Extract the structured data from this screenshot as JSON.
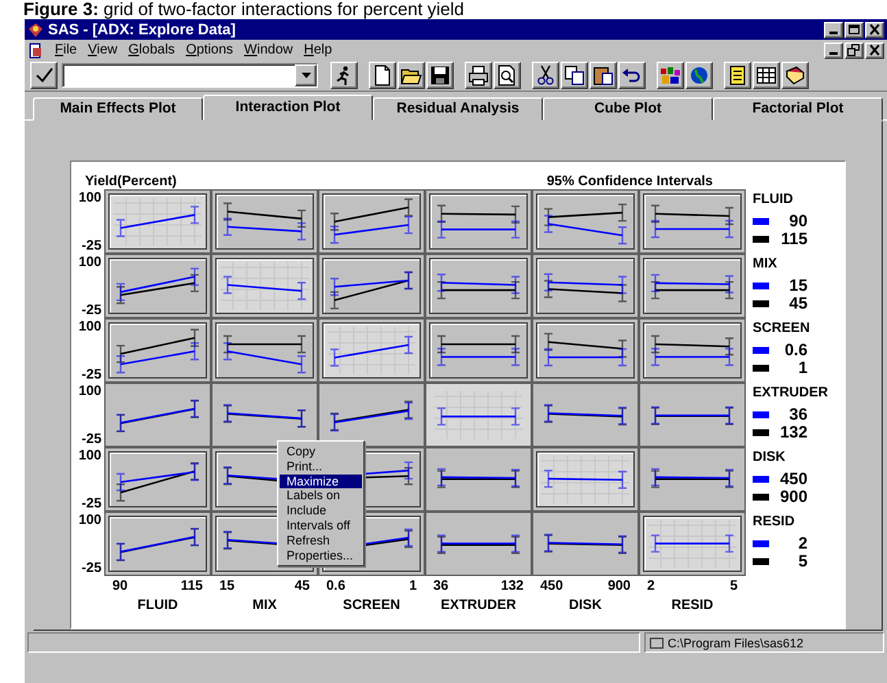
{
  "caption": "**Figure 3:** grid of two-factor interactions for percent yield",
  "window": {
    "title": "SAS - [ADX: Explore Data]"
  },
  "menu": [
    "File",
    "View",
    "Globals",
    "Options",
    "Window",
    "Help"
  ],
  "tabs": [
    {
      "label": "Main Effects Plot",
      "selected": false
    },
    {
      "label": "Interaction Plot",
      "selected": true
    },
    {
      "label": "Residual Analysis",
      "selected": false
    },
    {
      "label": "Cube Plot",
      "selected": false
    },
    {
      "label": "Factorial Plot",
      "selected": false
    }
  ],
  "plot": {
    "ylabel": "Yield(Percent)",
    "title": "95% Confidence Intervals"
  },
  "grid": {
    "columns": [
      {
        "ticks": [
          "90",
          "115"
        ],
        "name": "FLUID"
      },
      {
        "ticks": [
          "15",
          "45"
        ],
        "name": "MIX"
      },
      {
        "ticks": [
          "0.6",
          "1"
        ],
        "name": "SCREEN"
      },
      {
        "ticks": [
          "36",
          "132"
        ],
        "name": "EXTRUDER"
      },
      {
        "ticks": [
          "450",
          "900"
        ],
        "name": "DISK"
      },
      {
        "ticks": [
          "2",
          "5"
        ],
        "name": "RESID"
      }
    ],
    "rows": [
      {
        "yticks": [
          "100",
          "-25"
        ],
        "cells": [
          {
            "kind": "main",
            "framed": true
          },
          {
            "kind": "interaction",
            "framed": true
          },
          {
            "kind": "interaction",
            "framed": true
          },
          {
            "kind": "interaction",
            "framed": true
          },
          {
            "kind": "interaction",
            "framed": true
          },
          {
            "kind": "interaction",
            "framed": true
          }
        ]
      },
      {
        "yticks": [
          "100",
          "-25"
        ],
        "cells": [
          {
            "kind": "interaction",
            "framed": true
          },
          {
            "kind": "main",
            "framed": true
          },
          {
            "kind": "interaction",
            "framed": true
          },
          {
            "kind": "interaction",
            "framed": true
          },
          {
            "kind": "interaction",
            "framed": true
          },
          {
            "kind": "interaction",
            "framed": true
          }
        ]
      },
      {
        "yticks": [
          "100",
          "-25"
        ],
        "cells": [
          {
            "kind": "interaction",
            "framed": true
          },
          {
            "kind": "interaction",
            "framed": true
          },
          {
            "kind": "main",
            "framed": true
          },
          {
            "kind": "interaction",
            "framed": true
          },
          {
            "kind": "interaction",
            "framed": true
          },
          {
            "kind": "interaction",
            "framed": true
          }
        ]
      },
      {
        "yticks": [
          "100",
          "-25"
        ],
        "cells": [
          {
            "kind": "interaction",
            "framed": false
          },
          {
            "kind": "interaction",
            "framed": false
          },
          {
            "kind": "interaction",
            "framed": false
          },
          {
            "kind": "main",
            "framed": false
          },
          {
            "kind": "interaction",
            "framed": false
          },
          {
            "kind": "interaction",
            "framed": false
          }
        ]
      },
      {
        "yticks": [
          "100",
          "-25"
        ],
        "cells": [
          {
            "kind": "interaction",
            "framed": true
          },
          {
            "kind": "interaction",
            "framed": true
          },
          {
            "kind": "interaction",
            "framed": true
          },
          {
            "kind": "interaction",
            "framed": false
          },
          {
            "kind": "main",
            "framed": true
          },
          {
            "kind": "interaction",
            "framed": false
          }
        ]
      },
      {
        "yticks": [
          "100",
          "-25"
        ],
        "cells": [
          {
            "kind": "interaction",
            "framed": true
          },
          {
            "kind": "interaction",
            "framed": true
          },
          {
            "kind": "interaction",
            "framed": true
          },
          {
            "kind": "interaction",
            "framed": false
          },
          {
            "kind": "interaction",
            "framed": false
          },
          {
            "kind": "main",
            "framed": true
          }
        ]
      }
    ]
  },
  "legend": [
    {
      "factor": "FLUID",
      "levels": [
        {
          "label": "90",
          "color": "#0000ff"
        },
        {
          "label": "115",
          "color": "#000000"
        }
      ]
    },
    {
      "factor": "MIX",
      "levels": [
        {
          "label": "15",
          "color": "#0000ff"
        },
        {
          "label": "45",
          "color": "#000000"
        }
      ]
    },
    {
      "factor": "SCREEN",
      "levels": [
        {
          "label": "0.6",
          "color": "#0000ff"
        },
        {
          "label": "1",
          "color": "#000000"
        }
      ]
    },
    {
      "factor": "EXTRUDER",
      "levels": [
        {
          "label": "36",
          "color": "#0000ff"
        },
        {
          "label": "132",
          "color": "#000000"
        }
      ]
    },
    {
      "factor": "DISK",
      "levels": [
        {
          "label": "450",
          "color": "#0000ff"
        },
        {
          "label": "900",
          "color": "#000000"
        }
      ]
    },
    {
      "factor": "RESID",
      "levels": [
        {
          "label": "2",
          "color": "#0000ff"
        },
        {
          "label": "5",
          "color": "#000000"
        }
      ]
    }
  ],
  "context_menu": [
    {
      "label": "Copy",
      "selected": false
    },
    {
      "label": "Print...",
      "selected": false
    },
    {
      "label": "Maximize",
      "selected": true
    },
    {
      "label": "Labels on",
      "selected": false
    },
    {
      "label": "Include",
      "selected": false
    },
    {
      "label": "Intervals off",
      "selected": false
    },
    {
      "label": "Refresh",
      "selected": false
    },
    {
      "label": "Properties...",
      "selected": false
    }
  ],
  "status_bar": {
    "path": "C:\\Program Files\\sas612"
  }
}
